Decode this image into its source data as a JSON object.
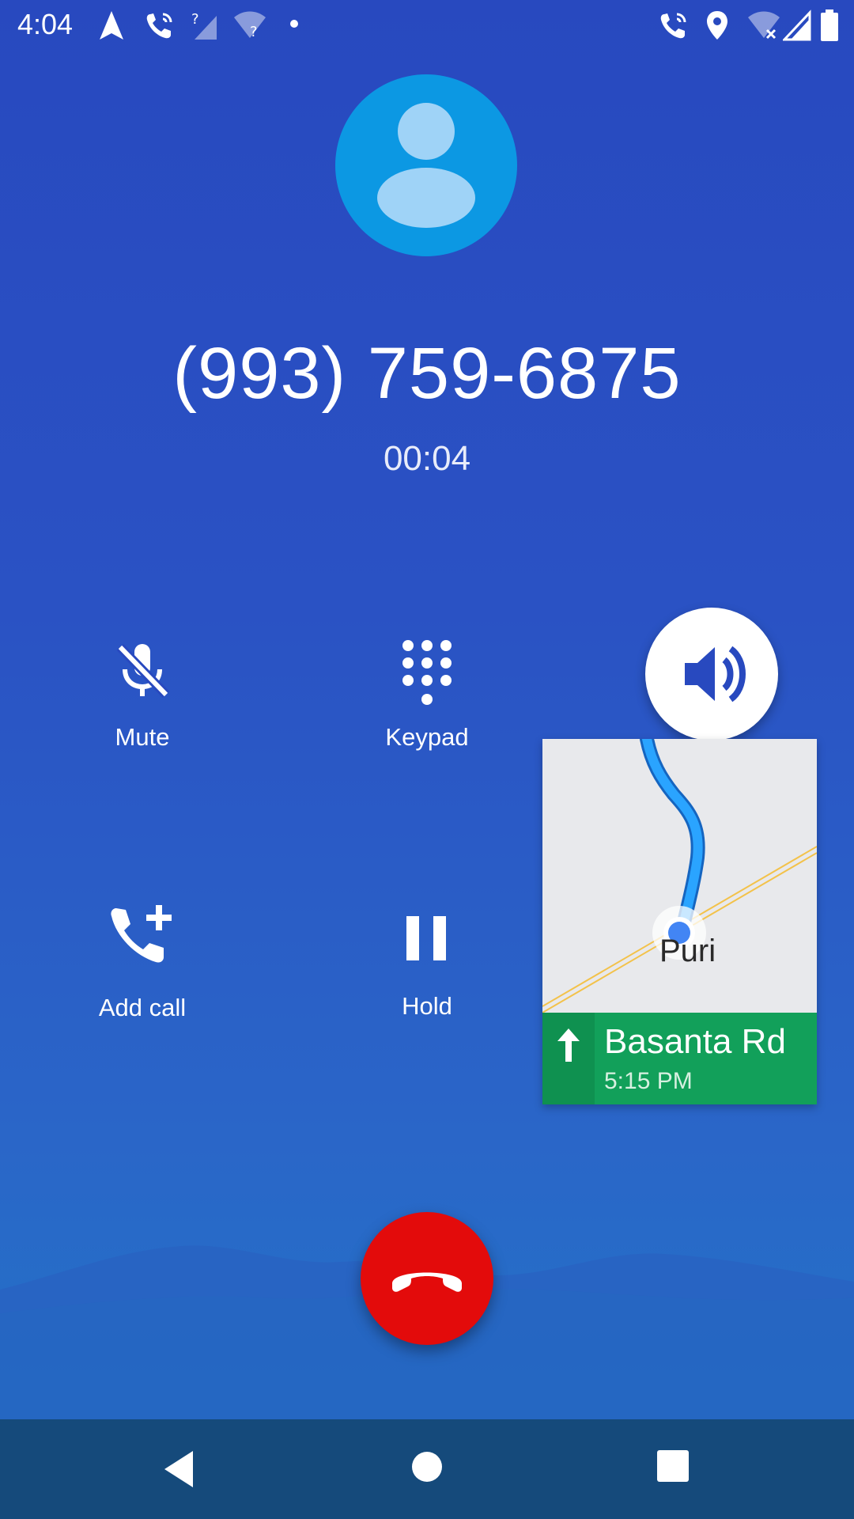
{
  "status_bar": {
    "time": "4:04",
    "icons_left": [
      "navigation-icon",
      "wifi-call-icon",
      "no-signal-icon",
      "wifi-unknown-icon",
      "dot-icon"
    ],
    "icons_right": [
      "wifi-call-icon",
      "location-icon",
      "wifi-off-icon",
      "signal-icon",
      "battery-icon"
    ]
  },
  "call": {
    "avatar_icon": "person-icon",
    "number": "(993) 759-6875",
    "timer": "00:04"
  },
  "controls": {
    "mute": "Mute",
    "keypad": "Keypad",
    "add_call": "Add call",
    "hold": "Hold",
    "speaker_icon": "speaker-icon"
  },
  "navigation_overlay": {
    "map_place": "Puri",
    "street": "Basanta Rd",
    "eta": "5:15 PM",
    "direction_icon": "arrow-up-icon"
  },
  "colors": {
    "background": "#2849bf",
    "end_call": "#e30b0b",
    "nav_green": "#12a05a",
    "route_blue": "#1e90ff"
  },
  "system_nav": {
    "back": "back-icon",
    "home": "home-icon",
    "recents": "recents-icon"
  }
}
